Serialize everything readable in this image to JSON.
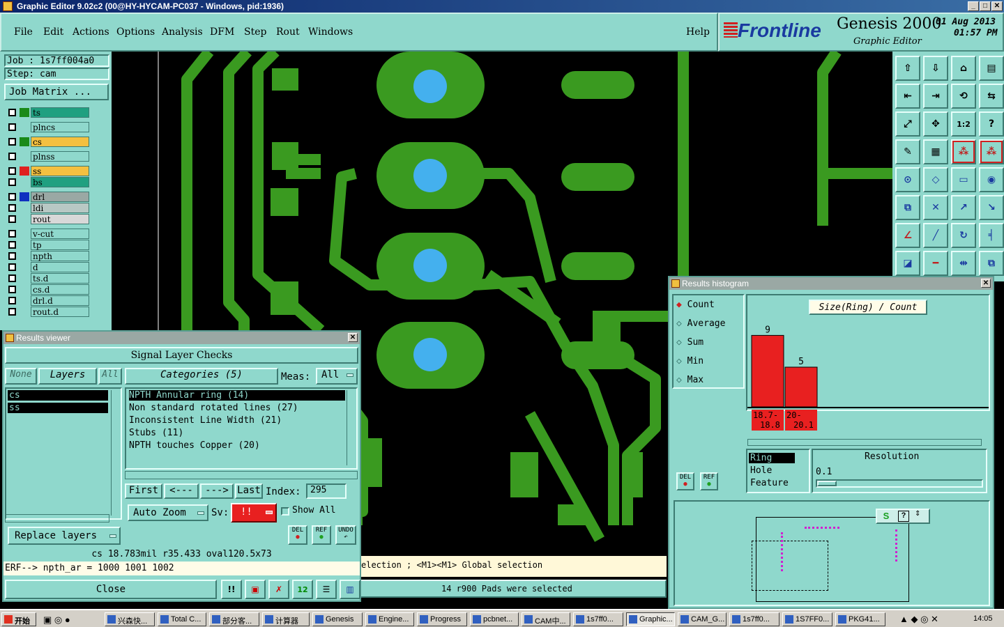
{
  "window": {
    "title": "Graphic Editor 9.02c2 (00@HY-HYCAM-PC037 - Windows, pid:1936)"
  },
  "menu": {
    "items": [
      "File",
      "Edit",
      "Actions",
      "Options",
      "Analysis",
      "DFM",
      "Step",
      "Rout",
      "Windows"
    ],
    "help": "Help"
  },
  "brand": {
    "logo": "Frontline",
    "product": "Genesis 2000",
    "subtitle": "Graphic Editor",
    "date": "01 Aug 2013",
    "time": "01:57 PM"
  },
  "job": {
    "job_label": "Job : 1s7ff004a0",
    "step_label": "Step: cam",
    "matrix_button": "Job Matrix ..."
  },
  "layers": [
    {
      "name": "ts",
      "swatch": "#1a8a1a",
      "bg": "#20a080"
    },
    {
      "name": "plncs",
      "swatch": "#8fd8cc",
      "bg": "#8fd8cc"
    },
    {
      "name": "cs",
      "swatch": "#1a8a1a",
      "bg": "#f4c040"
    },
    {
      "name": "plnss",
      "swatch": "#8fd8cc",
      "bg": "#8fd8cc"
    },
    {
      "name": "ss",
      "swatch": "#e02020",
      "bg": "#f4c040"
    },
    {
      "name": "bs",
      "swatch": "#8fd8cc",
      "bg": "#20a080"
    },
    {
      "name": "drl",
      "swatch": "#1030c0",
      "bg": "#9aa8a4"
    },
    {
      "name": "ldi",
      "swatch": "#8fd8cc",
      "bg": "#b8c8c4"
    },
    {
      "name": "rout",
      "swatch": "#8fd8cc",
      "bg": "#d8d8d8"
    },
    {
      "name": "v-cut",
      "swatch": "#8fd8cc",
      "bg": "#8fd8cc"
    },
    {
      "name": "tp",
      "swatch": "#8fd8cc",
      "bg": "#8fd8cc"
    },
    {
      "name": "npth",
      "swatch": "#8fd8cc",
      "bg": "#8fd8cc"
    },
    {
      "name": "d",
      "swatch": "#8fd8cc",
      "bg": "#8fd8cc"
    },
    {
      "name": "ts.d",
      "swatch": "#8fd8cc",
      "bg": "#8fd8cc"
    },
    {
      "name": "cs.d",
      "swatch": "#8fd8cc",
      "bg": "#8fd8cc"
    },
    {
      "name": "drl.d",
      "swatch": "#8fd8cc",
      "bg": "#8fd8cc"
    },
    {
      "name": "rout.d",
      "swatch": "#8fd8cc",
      "bg": "#8fd8cc"
    }
  ],
  "results_viewer": {
    "title": "Results viewer",
    "header": "Signal Layer Checks",
    "none_btn": "None",
    "layers_btn": "Layers",
    "all_btn": "All",
    "categories_btn": "Categories (5)",
    "meas_label": "Meas:",
    "meas_value": "All",
    "layer_list": [
      "cs",
      "ss"
    ],
    "categories": [
      "NPTH Annular ring (14)",
      "Non standard rotated lines (27)",
      "Inconsistent Line Width (21)",
      "Stubs (11)",
      "NPTH touches Copper (20)"
    ],
    "nav": {
      "first": "First",
      "prev": "<---",
      "next": "--->",
      "last": "Last",
      "index_label": "Index:",
      "index_value": "295"
    },
    "auto_zoom": "Auto Zoom",
    "sv_label": "Sv:",
    "sv_value": "!!",
    "show_all": "Show All",
    "replace_layers": "Replace layers",
    "del": "DEL",
    "ref": "REF",
    "undo": "UNDO",
    "info_line": "cs 18.783mil  r35.433  oval120.5x73",
    "erf_line": "ERF--> npth_ar = 1000 1001 1002",
    "close": "Close"
  },
  "status": {
    "selection_hint": "election ; <M1><M1> Global selection",
    "selected": "14 r900 Pads were selected"
  },
  "histogram": {
    "title": "Results histogram",
    "modes": [
      "Count",
      "Average",
      "Sum",
      "Min",
      "Max"
    ],
    "selected_mode": "Count",
    "chart_title": "Size(Ring) / Count",
    "list": [
      "Ring",
      "Hole",
      "Feature"
    ],
    "resolution_label": "Resolution",
    "resolution_value": "0.1",
    "del": "DEL",
    "ref": "REF"
  },
  "chart_data": {
    "type": "bar",
    "title": "Size(Ring) / Count",
    "categories": [
      "18.7-18.8",
      "20-20.1"
    ],
    "values": [
      9,
      5
    ],
    "ylim": [
      0,
      10
    ],
    "xlabel": "",
    "ylabel": ""
  },
  "taskbar": {
    "start": "开始",
    "tasks": [
      "兴森快...",
      "Total C...",
      "部分客...",
      "计算器",
      "Genesis",
      "Engine...",
      "Progress",
      "pcbnet...",
      "CAM中...",
      "1s7ff0...",
      "Graphic...",
      "CAM_G...",
      "1s7ff0...",
      "1S7FF0...",
      "PKG41..."
    ],
    "active_index": 10,
    "clock": "14:05"
  },
  "colors": {
    "teal": "#8fd8cc",
    "copper": "#3a9a20",
    "hole": "#44b0ee",
    "bar": "#e82020"
  }
}
